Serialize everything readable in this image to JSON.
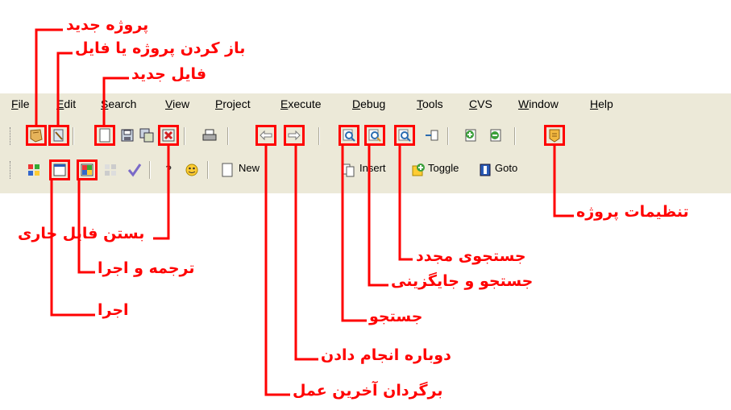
{
  "menu": [
    "File",
    "Edit",
    "Search",
    "View",
    "Project",
    "Execute",
    "Debug",
    "Tools",
    "CVS",
    "Window",
    "Help"
  ],
  "toolbar2_labels": {
    "new": "New",
    "insert": "Insert",
    "toggle": "Toggle",
    "goto": "Goto"
  },
  "annotations": {
    "new_project": "پروژه جدید",
    "open_project": "باز کردن پروژه یا فایل",
    "new_file": "فایل جدید",
    "close_file": "بستن فایل جاری",
    "compile_run": "ترجمه و اجرا",
    "run": "اجرا",
    "project_options": "تنظیمات پروژه",
    "find_again": "جستجوی مجدد",
    "find_replace": "جستجو و جایگزینی",
    "find": "جستجو",
    "redo": "دوباره انجام دادن",
    "undo": "برگردان آخرین عمل"
  },
  "colors": {
    "annotation": "#ff0000",
    "toolbar_bg": "#ece9d8"
  },
  "icons": [
    "new-project-icon",
    "open-project-icon",
    "new-file-icon",
    "save-icon",
    "save-all-icon",
    "close-file-icon",
    "print-icon",
    "undo-icon",
    "redo-icon",
    "find-icon",
    "replace-icon",
    "find-again-icon",
    "goto-line-icon",
    "add-to-project-icon",
    "remove-from-project-icon",
    "project-options-icon",
    "compile-icon",
    "run-icon",
    "compile-run-icon",
    "rebuild-icon",
    "syntax-check-icon",
    "help-icon",
    "about-icon",
    "new-class-icon",
    "insert-icon",
    "toggle-bookmark-icon",
    "goto-bookmark-icon"
  ]
}
